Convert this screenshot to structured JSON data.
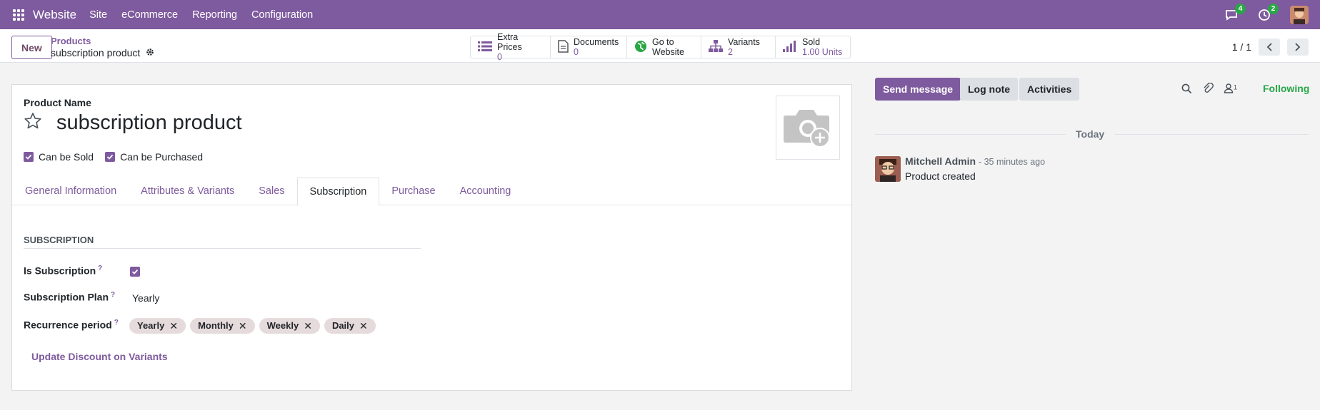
{
  "navbar": {
    "app_name": "Website",
    "menu": [
      "Site",
      "eCommerce",
      "Reporting",
      "Configuration"
    ],
    "messages_badge": "4",
    "activities_badge": "2"
  },
  "control": {
    "new_label": "New",
    "breadcrumb_parent": "Products",
    "breadcrumb_current": "subscription product",
    "stats": [
      {
        "label": "Extra Prices",
        "value": "0",
        "icon": "list-icon"
      },
      {
        "label": "Documents",
        "value": "0",
        "icon": "file-icon"
      },
      {
        "label": "Go to",
        "value": "Website",
        "icon": "globe-icon"
      },
      {
        "label": "Variants",
        "value": "2",
        "icon": "sitemap-icon"
      },
      {
        "label": "Sold",
        "value": "1.00 Units",
        "icon": "signal-icon"
      }
    ],
    "pager": "1 / 1"
  },
  "form": {
    "product_name_label": "Product Name",
    "product_name": "subscription product",
    "can_be_sold": "Can be Sold",
    "can_be_purchased": "Can be Purchased",
    "tabs": [
      "General Information",
      "Attributes & Variants",
      "Sales",
      "Subscription",
      "Purchase",
      "Accounting"
    ],
    "active_tab": "Subscription",
    "section_title": "SUBSCRIPTION",
    "is_subscription_label": "Is Subscription",
    "subscription_plan_label": "Subscription Plan",
    "subscription_plan_value": "Yearly",
    "recurrence_label": "Recurrence period",
    "recurrence_tags": [
      "Yearly",
      "Monthly",
      "Weekly",
      "Daily"
    ],
    "update_discount": "Update Discount on Variants",
    "help_mark": "?"
  },
  "chatter": {
    "send_message": "Send message",
    "log_note": "Log note",
    "activities": "Activities",
    "followers_count": "1",
    "following": "Following",
    "today": "Today",
    "author": "Mitchell Admin",
    "time": "- 35 minutes ago",
    "body": "Product created"
  },
  "colors": {
    "brand": "#7e5a9e",
    "success": "#28a745"
  }
}
